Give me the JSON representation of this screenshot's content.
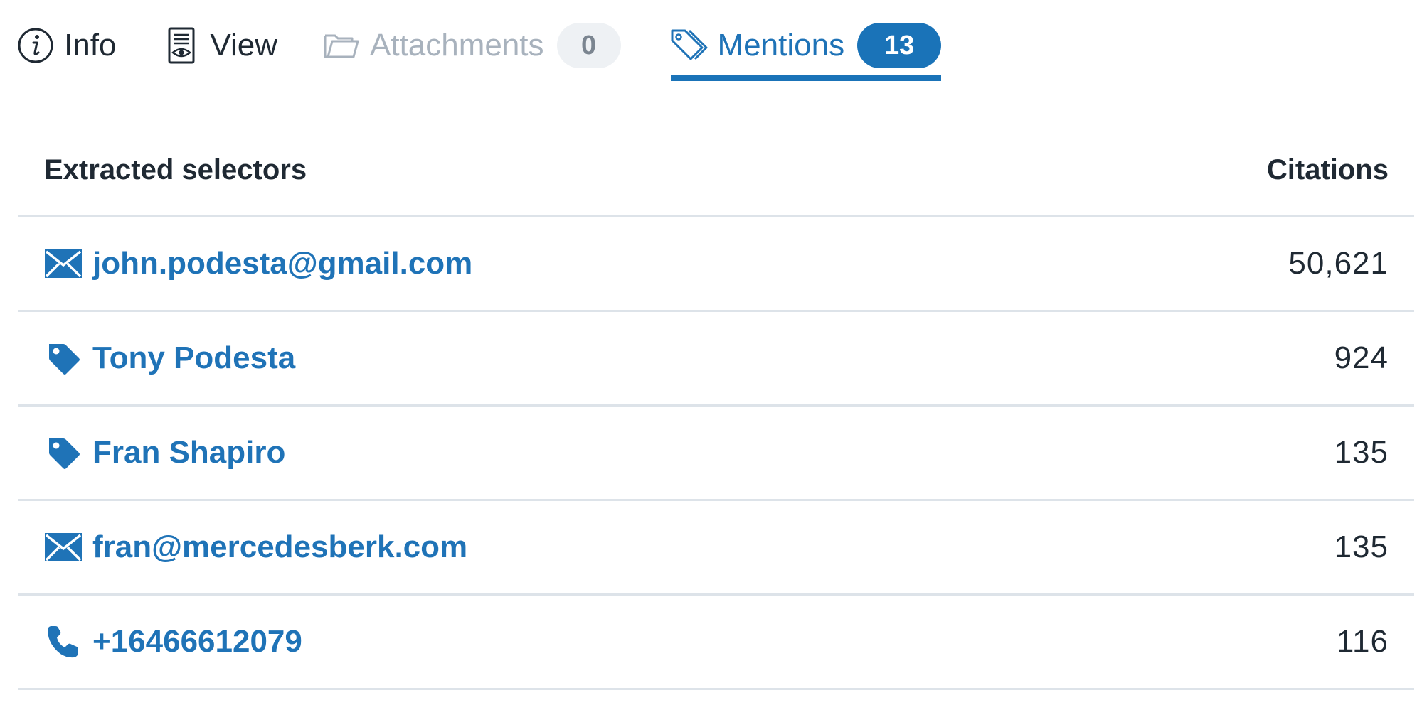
{
  "tabs": {
    "info": {
      "label": "Info",
      "icon": "info-icon"
    },
    "view": {
      "label": "View",
      "icon": "document-view-icon"
    },
    "attachments": {
      "label": "Attachments",
      "count": "0",
      "icon": "folder-icon"
    },
    "mentions": {
      "label": "Mentions",
      "count": "13",
      "icon": "tags-icon",
      "active": true
    }
  },
  "table": {
    "header_selectors": "Extracted selectors",
    "header_citations": "Citations",
    "rows": [
      {
        "type": "email",
        "icon": "envelope-icon",
        "selector": "john.podesta@gmail.com",
        "citations": "50,621"
      },
      {
        "type": "name",
        "icon": "tag-icon",
        "selector": "Tony Podesta",
        "citations": "924"
      },
      {
        "type": "name",
        "icon": "tag-icon",
        "selector": "Fran Shapiro",
        "citations": "135"
      },
      {
        "type": "email",
        "icon": "envelope-icon",
        "selector": "fran@mercedesberk.com",
        "citations": "135"
      },
      {
        "type": "phone",
        "icon": "phone-icon",
        "selector": "+16466612079",
        "citations": "116"
      }
    ]
  },
  "colors": {
    "accent": "#1a73b8",
    "link": "#1f73b7",
    "text": "#1f2933",
    "muted": "#a8b2bd",
    "divider": "#dde3e9",
    "badge_grey_bg": "#eef1f4"
  }
}
